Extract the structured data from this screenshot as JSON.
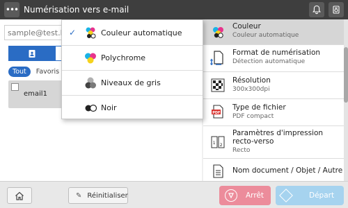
{
  "header": {
    "menu_glyph": "•••",
    "title": "Numérisation vers e-mail",
    "icons": [
      "bell-icon",
      "status-icon"
    ]
  },
  "left": {
    "address_placeholder": "sample@test.lo",
    "filters": {
      "all": "Tout",
      "favorites": "Favoris"
    },
    "list": [
      {
        "label": "email1"
      }
    ]
  },
  "dropdown": {
    "items": [
      {
        "label": "Couleur automatique",
        "selected": true,
        "icon": "auto-color-icon"
      },
      {
        "label": "Polychrome",
        "selected": false,
        "icon": "full-color-icon"
      },
      {
        "label": "Niveaux de gris",
        "selected": false,
        "icon": "grayscale-icon"
      },
      {
        "label": "Noir",
        "selected": false,
        "icon": "black-icon"
      }
    ],
    "check_glyph": "✓"
  },
  "settings": {
    "items": [
      {
        "title": "Couleur",
        "value": "Couleur automatique",
        "icon": "color-icon",
        "selected": true
      },
      {
        "title": "Format de numérisation",
        "value": "Détection automatique",
        "icon": "scan-format-icon"
      },
      {
        "title": "Résolution",
        "value": "300x300dpi",
        "icon": "resolution-icon"
      },
      {
        "title": "Type de fichier",
        "value": "PDF compact",
        "icon": "pdf-file-icon"
      },
      {
        "title": "Paramètres d'impression recto-verso",
        "value": "Recto",
        "icon": "duplex-icon"
      },
      {
        "title": "Nom document / Objet / Autre",
        "value": "",
        "icon": "document-icon"
      }
    ]
  },
  "footer": {
    "reset_label": "Réinitialiser",
    "stop_label": "Arrêt",
    "start_label": "Départ"
  },
  "colors": {
    "topbar": "#3e3e3e",
    "accent_blue": "#2a6cc4",
    "stop": "#ec8c9b",
    "start": "#a6d3ef"
  }
}
